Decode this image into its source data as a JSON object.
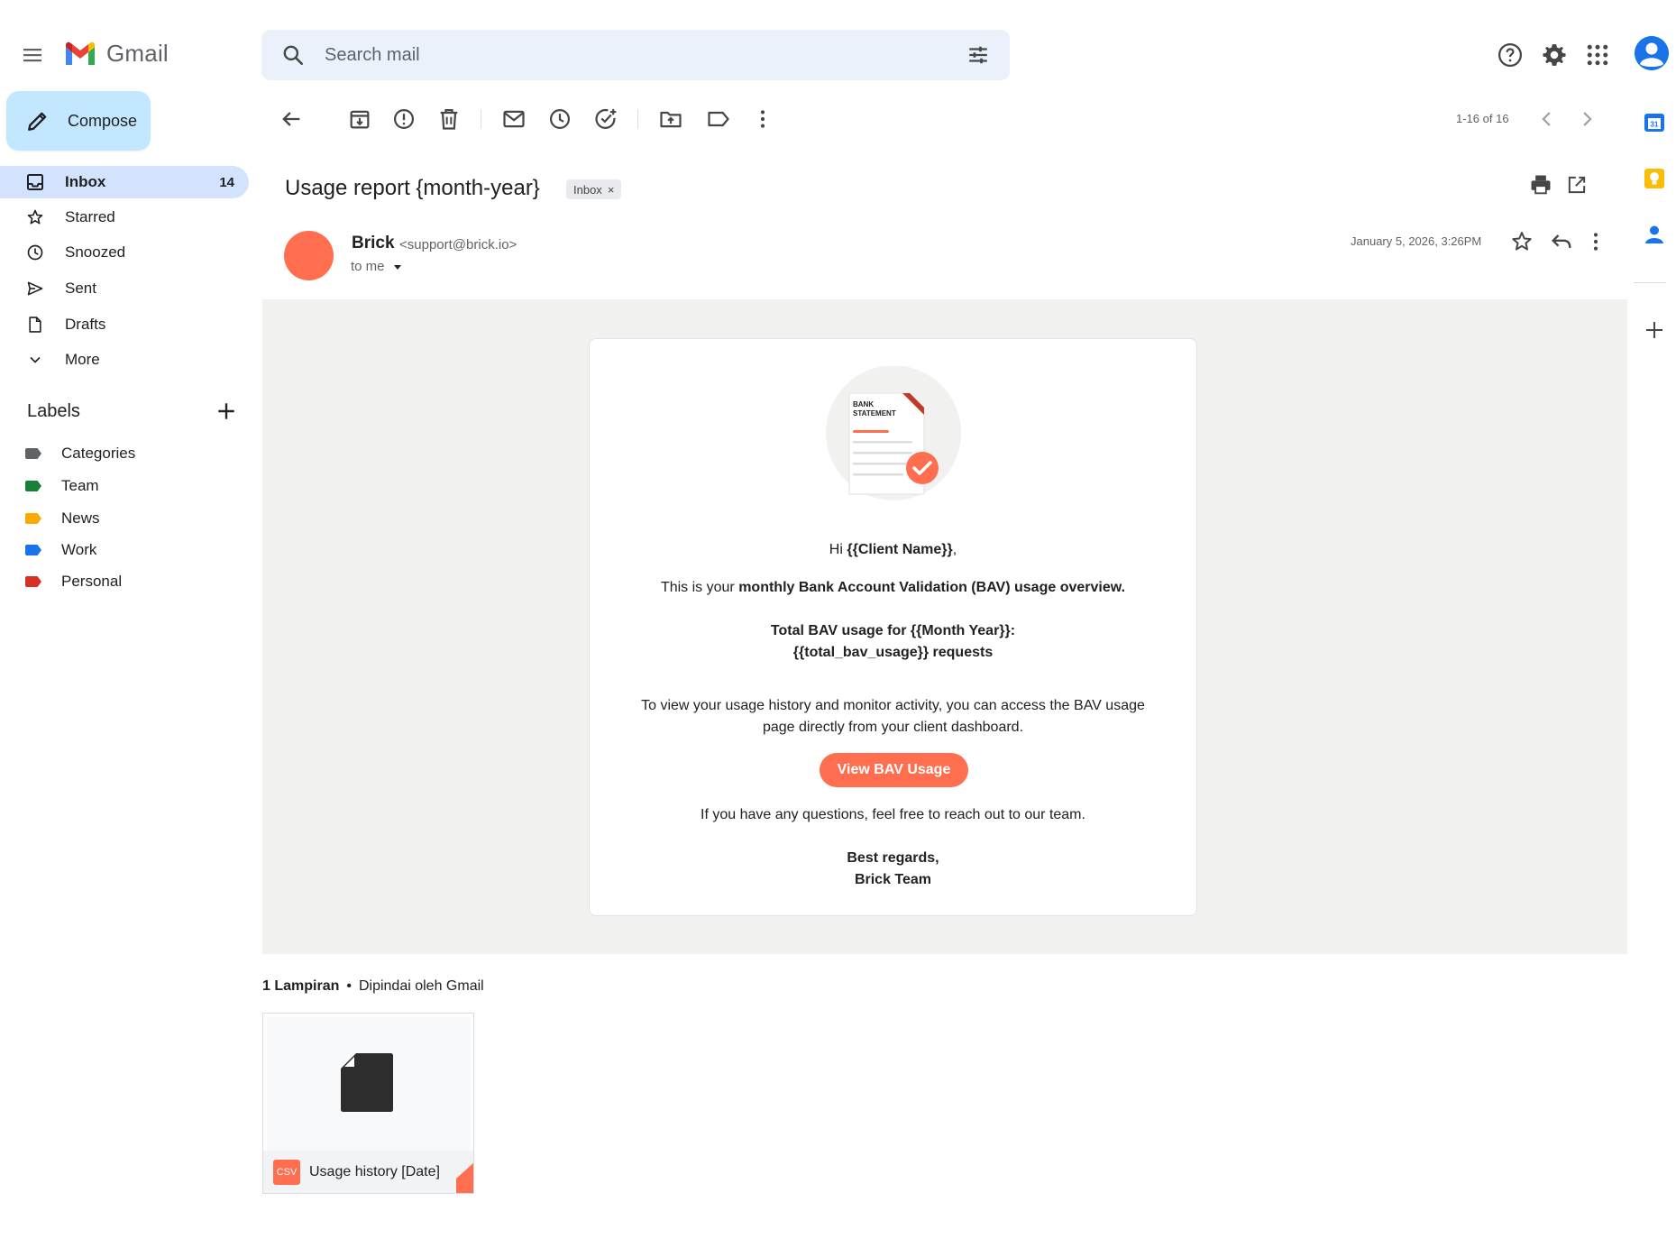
{
  "app": {
    "name": "Gmail"
  },
  "search": {
    "placeholder": "Search mail"
  },
  "compose": {
    "label": "Compose"
  },
  "nav": [
    {
      "label": "Inbox",
      "count": "14",
      "active": true,
      "icon": "inbox-icon"
    },
    {
      "label": "Starred",
      "count": "",
      "icon": "star-icon"
    },
    {
      "label": "Snoozed",
      "count": "",
      "icon": "clock-icon"
    },
    {
      "label": "Sent",
      "count": "",
      "icon": "send-icon"
    },
    {
      "label": "Drafts",
      "count": "",
      "icon": "draft-icon"
    },
    {
      "label": "More",
      "count": "",
      "icon": "chevron-down-icon"
    }
  ],
  "labels": {
    "title": "Labels",
    "items": [
      {
        "name": "Categories",
        "color": "#5f6368"
      },
      {
        "name": "Team",
        "color": "#188038"
      },
      {
        "name": "News",
        "color": "#f9ab00"
      },
      {
        "name": "Work",
        "color": "#1a73e8"
      },
      {
        "name": "Personal",
        "color": "#d93025"
      }
    ]
  },
  "pager": {
    "text": "1-16 of 16"
  },
  "email": {
    "subject": "Usage report {month-year}",
    "chip": "Inbox",
    "chip_close": "×",
    "sender_name": "Brick",
    "sender_email": "<support@brick.io>",
    "to": "to me",
    "date": "January 5, 2026, 3:26PM",
    "avatar_color": "#ff6f4f"
  },
  "body": {
    "illustration": {
      "line1": "BANK",
      "line2": "STATEMENT"
    },
    "greeting_prefix": "Hi ",
    "greeting_name": "{{Client Name}}",
    "greeting_suffix": ",",
    "intro_prefix": "This is your ",
    "intro_bold": "monthly Bank Account Validation (BAV) usage overview.",
    "total_line1": "Total BAV usage for {{Month Year}}:",
    "total_line2": "{{total_bav_usage}} requests",
    "view_line1": "To view your usage history and monitor activity, you can access the BAV usage",
    "view_line2": "page directly from your client dashboard.",
    "cta": "View BAV Usage",
    "questions": "If you have any questions, feel free to reach out to our team.",
    "regards": "Best regards,",
    "team": "Brick Team"
  },
  "attachments": {
    "count_label": "1 Lampiran",
    "bullet": "•",
    "scanned": "Dipindai oleh Gmail",
    "file": {
      "badge": "CSV",
      "name": "Usage history [Date]"
    }
  },
  "colors": {
    "accent": "#ff6f4f",
    "compose_bg": "#c2e7ff",
    "active_nav": "#d3e3fd",
    "body_bg": "#f1f2f0"
  }
}
